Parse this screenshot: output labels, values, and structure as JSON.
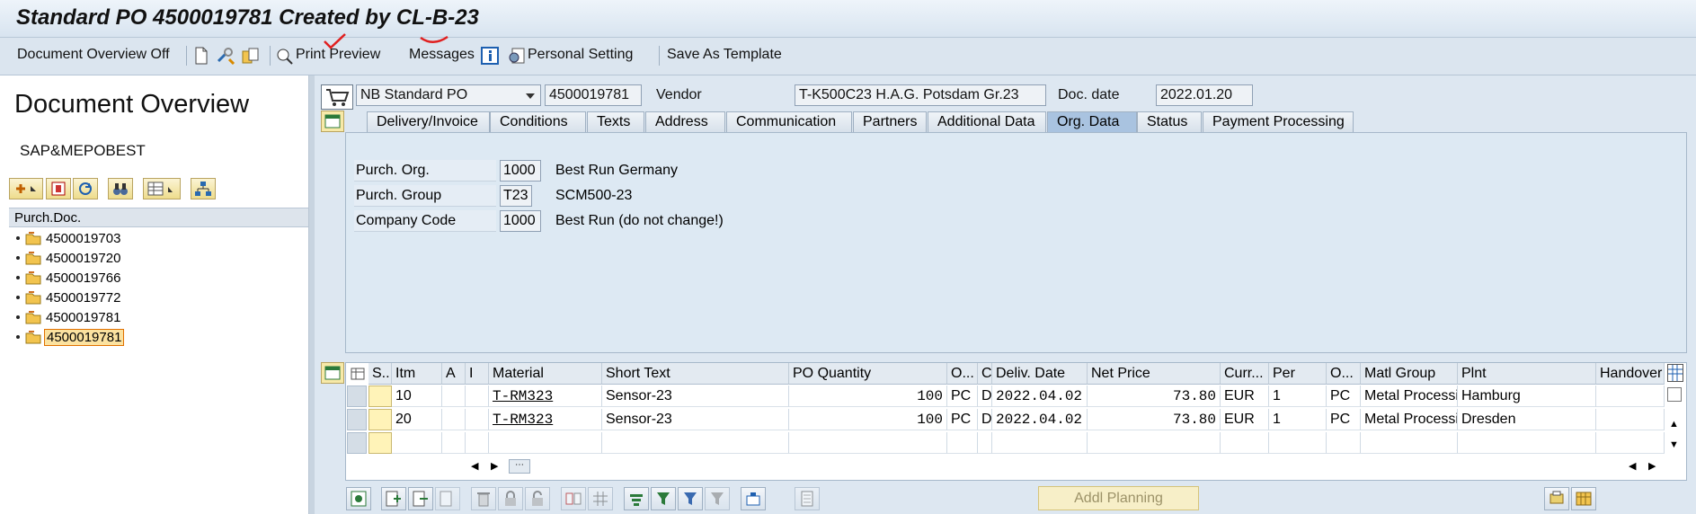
{
  "window": {
    "title": "Standard PO 4500019781 Created by CL-B-23"
  },
  "toolbar": {
    "doc_overview_off": "Document Overview Off",
    "print_preview": "Print Preview",
    "messages": "Messages",
    "personal_setting": "Personal Setting",
    "save_as_template": "Save As Template"
  },
  "left_panel": {
    "title": "Document Overview",
    "variant": "SAP&MEPOBEST",
    "tree_header": "Purch.Doc.",
    "documents": [
      "4500019703",
      "4500019720",
      "4500019766",
      "4500019772",
      "4500019781",
      "4500019781"
    ],
    "selected_index": 5
  },
  "header": {
    "doc_type": "NB Standard PO",
    "po_number": "4500019781",
    "vendor_label": "Vendor",
    "vendor_value": "T-K500C23 H.A.G. Potsdam Gr.23",
    "doc_date_label": "Doc. date",
    "doc_date_value": "2022.01.20"
  },
  "tabs": [
    "Delivery/Invoice",
    "Conditions",
    "Texts",
    "Address",
    "Communication",
    "Partners",
    "Additional Data",
    "Org. Data",
    "Status",
    "Payment Processing"
  ],
  "active_tab": "Org. Data",
  "org_data": {
    "purch_org_label": "Purch. Org.",
    "purch_org_value": "1000",
    "purch_org_desc": "Best Run Germany",
    "purch_group_label": "Purch. Group",
    "purch_group_value": "T23",
    "purch_group_desc": "SCM500-23",
    "company_code_label": "Company Code",
    "company_code_value": "1000",
    "company_code_desc": "Best Run (do not change!)"
  },
  "items_grid": {
    "columns": [
      "S..",
      "Itm",
      "A",
      "I",
      "Material",
      "Short Text",
      "PO Quantity",
      "O...",
      "C",
      "Deliv. Date",
      "Net Price",
      "Curr...",
      "Per",
      "O...",
      "Matl Group",
      "Plnt",
      "Handover"
    ],
    "rows": [
      {
        "itm": "10",
        "material": "T-RM323",
        "short_text": "Sensor-23",
        "qty": "100",
        "ou": "PC",
        "c": "D",
        "deliv_date": "2022.04.02",
        "net_price": "73.80",
        "curr": "EUR",
        "per": "1",
        "opu": "PC",
        "matl_group": "Metal Processi...",
        "plant": "Hamburg"
      },
      {
        "itm": "20",
        "material": "T-RM323",
        "short_text": "Sensor-23",
        "qty": "100",
        "ou": "PC",
        "c": "D",
        "deliv_date": "2022.04.02",
        "net_price": "73.80",
        "curr": "EUR",
        "per": "1",
        "opu": "PC",
        "matl_group": "Metal Processi...",
        "plant": "Dresden"
      }
    ]
  },
  "bottom_bar": {
    "addl_planning": "Addl Planning"
  },
  "colors": {
    "accent_orange": "#e07000",
    "panel_bg": "#dde7f1",
    "active_tab": "#a9c3e0",
    "annotation_red": "#e02020"
  }
}
